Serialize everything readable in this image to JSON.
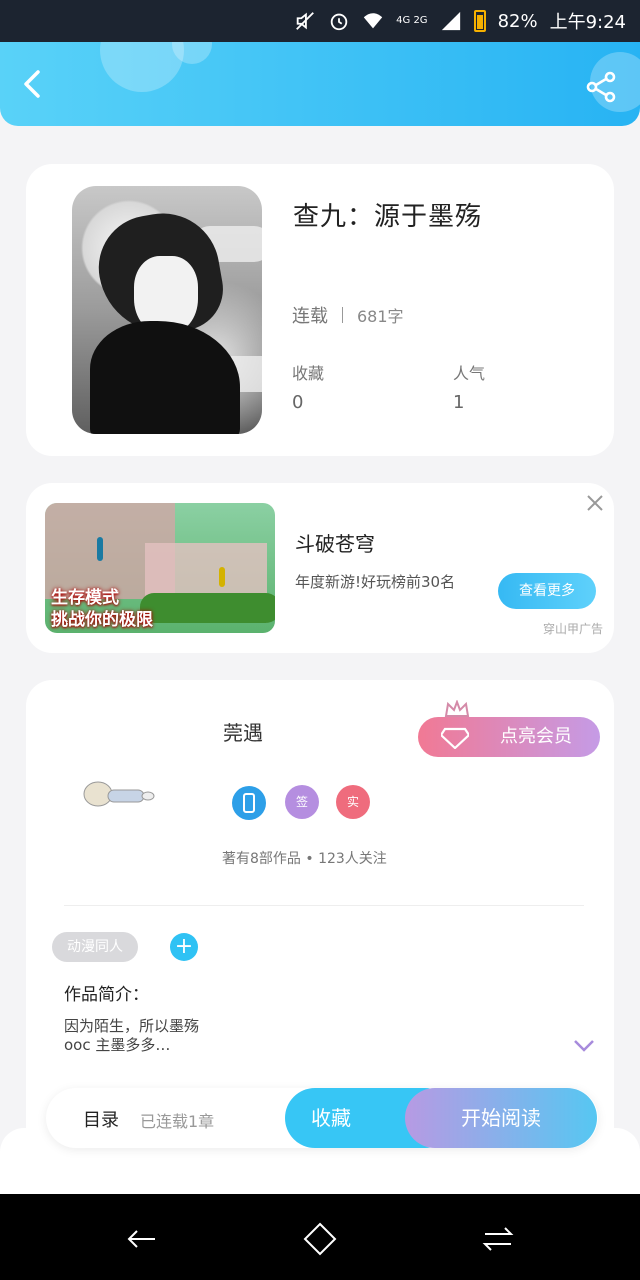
{
  "status_bar": {
    "battery": "82%",
    "time": "上午9:24",
    "network": "4G 2G"
  },
  "header": {
    "back_icon": "back-icon",
    "share_icon": "share-icon"
  },
  "book": {
    "title": "查九：源于墨殇",
    "status": "连载",
    "word_count": "681字",
    "favorites_label": "收藏",
    "favorites_value": "0",
    "popularity_label": "人气",
    "popularity_value": "1"
  },
  "ad": {
    "title": "斗破苍穹",
    "description": "年度新游!好玩榜前30名",
    "button_label": "查看更多",
    "source": "穿山甲广告",
    "image_slogan_line1": "生存模式",
    "image_slogan_line2": "挑战你的极限"
  },
  "author": {
    "name": "莞遇",
    "vip_button": "点亮会员",
    "badges": [
      "签",
      "实"
    ],
    "meta": "著有8部作品 • 123人关注",
    "colors": {
      "badge_sign": "#b58ee0",
      "badge_real": "#ef6c7d"
    }
  },
  "intro": {
    "tag": "动漫同人",
    "add_label": "+",
    "label": "作品简介：",
    "text": "因为陌生，所以墨殇\nooc 主墨多多…"
  },
  "actions": {
    "toc_label": "目录",
    "toc_count": "已连载1章",
    "favorite_button": "收藏",
    "read_button": "开始阅读"
  },
  "colors": {
    "accent": "#27b3f3",
    "header_start": "#59d2f8",
    "vip_start": "#f17994",
    "vip_end": "#c59be6"
  }
}
